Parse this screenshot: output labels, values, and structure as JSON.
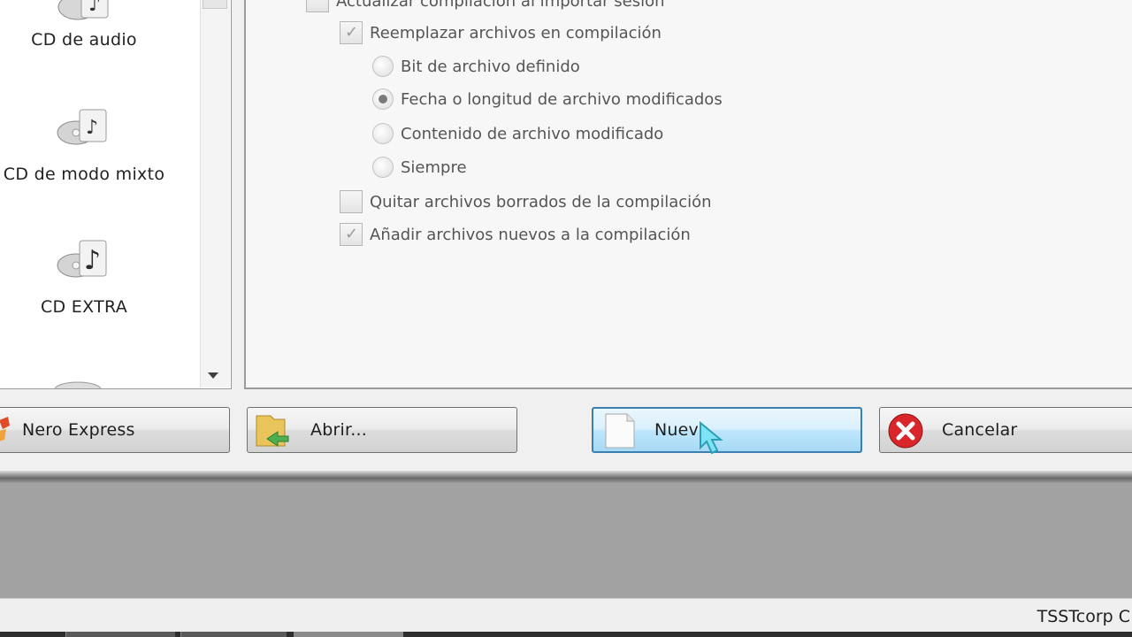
{
  "left_list": {
    "items": [
      {
        "label": "CD de audio",
        "icon": "audio-cd-icon"
      },
      {
        "label": "CD de modo mixto",
        "icon": "mixed-mode-cd-icon"
      },
      {
        "label": "CD EXTRA",
        "icon": "cd-extra-icon"
      }
    ]
  },
  "options": {
    "update_on_import": {
      "label": "Actualizar compilación al importar sesión",
      "checked": false
    },
    "replace_files": {
      "label": "Reemplazar archivos en compilación",
      "checked": true
    },
    "radio_options": [
      {
        "label": "Bit de archivo definido",
        "selected": false
      },
      {
        "label": "Fecha o longitud de archivo modificados",
        "selected": true
      },
      {
        "label": "Contenido de archivo modificado",
        "selected": false
      },
      {
        "label": "Siempre",
        "selected": false
      }
    ],
    "remove_deleted": {
      "label": "Quitar archivos borrados de la compilación",
      "checked": false
    },
    "add_new": {
      "label": "Añadir archivos nuevos a la compilación",
      "checked": true
    }
  },
  "buttons": {
    "nero_express": "Nero Express",
    "open": "Abrir...",
    "new": "Nuevo",
    "cancel": "Cancelar"
  },
  "status_bar": {
    "drive_text": "TSSTcorp C"
  },
  "colors": {
    "focus_border": "#3c7fb1",
    "cancel_red": "#d8262b",
    "option_text": "#555555"
  }
}
